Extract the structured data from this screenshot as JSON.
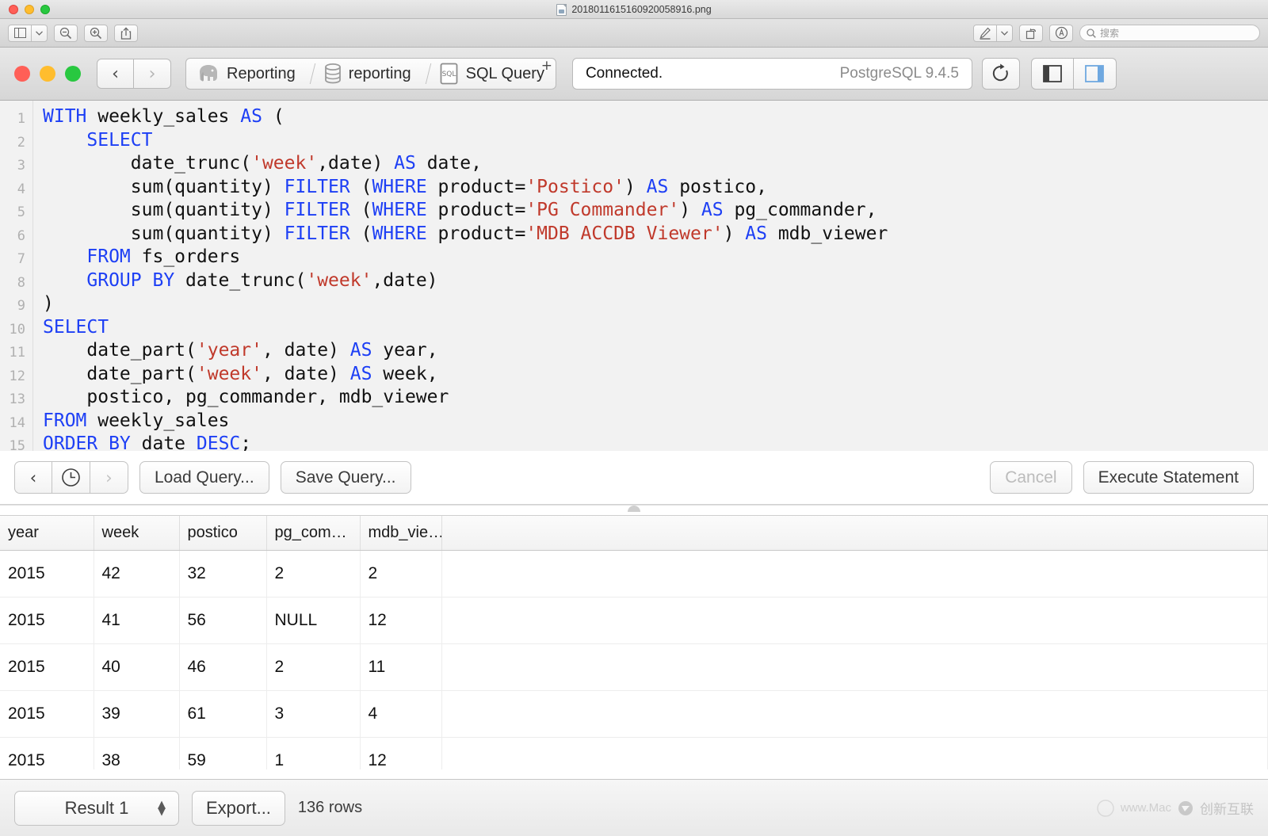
{
  "preview_window": {
    "title": "2018011615160920058916.png",
    "toolbar": {
      "sidebar_button": "sidebar-view",
      "sidebar_dropdown": "⌄",
      "zoom_out": "zoom-out",
      "zoom_in": "zoom-in",
      "share": "share",
      "markup": "markup",
      "markup_dropdown": "⌄",
      "rotate": "rotate",
      "annotate": "annotate"
    },
    "search": {
      "placeholder": "搜索"
    }
  },
  "app": {
    "breadcrumbs": [
      {
        "label": "Reporting",
        "icon": "elephant-icon"
      },
      {
        "label": "reporting",
        "icon": "database-icon"
      },
      {
        "label": "SQL Query",
        "icon": "sql-icon",
        "badge": "+"
      }
    ],
    "nav": {
      "back": "‹",
      "forward": "›"
    },
    "status": {
      "text": "Connected.",
      "version": "PostgreSQL 9.4.5"
    },
    "toolbar_icons": {
      "refresh": "refresh-icon",
      "left_pane": "left-pane-icon",
      "right_pane": "right-pane-icon"
    },
    "accent_color": "#4a90e2"
  },
  "editor": {
    "line_numbers": [
      "1",
      "2",
      "3",
      "4",
      "5",
      "6",
      "7",
      "8",
      "9",
      "10",
      "11",
      "12",
      "13",
      "14",
      "15"
    ],
    "lines": [
      [
        {
          "t": "WITH",
          "c": "kw"
        },
        {
          "t": " weekly_sales ",
          "c": "pl"
        },
        {
          "t": "AS",
          "c": "kw"
        },
        {
          "t": " (",
          "c": "pl"
        }
      ],
      [
        {
          "t": "    ",
          "c": "pl"
        },
        {
          "t": "SELECT",
          "c": "kw"
        }
      ],
      [
        {
          "t": "        date_trunc(",
          "c": "pl"
        },
        {
          "t": "'week'",
          "c": "str"
        },
        {
          "t": ",date) ",
          "c": "pl"
        },
        {
          "t": "AS",
          "c": "kw"
        },
        {
          "t": " date,",
          "c": "pl"
        }
      ],
      [
        {
          "t": "        sum(quantity) ",
          "c": "pl"
        },
        {
          "t": "FILTER",
          "c": "kw"
        },
        {
          "t": " (",
          "c": "pl"
        },
        {
          "t": "WHERE",
          "c": "kw"
        },
        {
          "t": " product=",
          "c": "pl"
        },
        {
          "t": "'Postico'",
          "c": "str"
        },
        {
          "t": ") ",
          "c": "pl"
        },
        {
          "t": "AS",
          "c": "kw"
        },
        {
          "t": " postico,",
          "c": "pl"
        }
      ],
      [
        {
          "t": "        sum(quantity) ",
          "c": "pl"
        },
        {
          "t": "FILTER",
          "c": "kw"
        },
        {
          "t": " (",
          "c": "pl"
        },
        {
          "t": "WHERE",
          "c": "kw"
        },
        {
          "t": " product=",
          "c": "pl"
        },
        {
          "t": "'PG Commander'",
          "c": "str"
        },
        {
          "t": ") ",
          "c": "pl"
        },
        {
          "t": "AS",
          "c": "kw"
        },
        {
          "t": " pg_commander,",
          "c": "pl"
        }
      ],
      [
        {
          "t": "        sum(quantity) ",
          "c": "pl"
        },
        {
          "t": "FILTER",
          "c": "kw"
        },
        {
          "t": " (",
          "c": "pl"
        },
        {
          "t": "WHERE",
          "c": "kw"
        },
        {
          "t": " product=",
          "c": "pl"
        },
        {
          "t": "'MDB ACCDB Viewer'",
          "c": "str"
        },
        {
          "t": ") ",
          "c": "pl"
        },
        {
          "t": "AS",
          "c": "kw"
        },
        {
          "t": " mdb_viewer",
          "c": "pl"
        }
      ],
      [
        {
          "t": "    ",
          "c": "pl"
        },
        {
          "t": "FROM",
          "c": "kw"
        },
        {
          "t": " fs_orders",
          "c": "pl"
        }
      ],
      [
        {
          "t": "    ",
          "c": "pl"
        },
        {
          "t": "GROUP BY",
          "c": "kw"
        },
        {
          "t": " date_trunc(",
          "c": "pl"
        },
        {
          "t": "'week'",
          "c": "str"
        },
        {
          "t": ",date)",
          "c": "pl"
        }
      ],
      [
        {
          "t": ")",
          "c": "pl"
        }
      ],
      [
        {
          "t": "SELECT",
          "c": "kw"
        }
      ],
      [
        {
          "t": "    date_part(",
          "c": "pl"
        },
        {
          "t": "'year'",
          "c": "str"
        },
        {
          "t": ", date) ",
          "c": "pl"
        },
        {
          "t": "AS",
          "c": "kw"
        },
        {
          "t": " year,",
          "c": "pl"
        }
      ],
      [
        {
          "t": "    date_part(",
          "c": "pl"
        },
        {
          "t": "'week'",
          "c": "str"
        },
        {
          "t": ", date) ",
          "c": "pl"
        },
        {
          "t": "AS",
          "c": "kw"
        },
        {
          "t": " week,",
          "c": "pl"
        }
      ],
      [
        {
          "t": "    postico, pg_commander, mdb_viewer",
          "c": "pl"
        }
      ],
      [
        {
          "t": "FROM",
          "c": "kw"
        },
        {
          "t": " weekly_sales",
          "c": "pl"
        }
      ],
      [
        {
          "t": "ORDER BY",
          "c": "kw"
        },
        {
          "t": " date ",
          "c": "pl"
        },
        {
          "t": "DESC",
          "c": "kw"
        },
        {
          "t": ";",
          "c": "pl"
        }
      ]
    ]
  },
  "query_bar": {
    "history_prev": "‹",
    "history_clock": "clock-icon",
    "history_next": "›",
    "load_query": "Load Query...",
    "save_query": "Save Query...",
    "cancel": "Cancel",
    "execute": "Execute Statement"
  },
  "results": {
    "columns": [
      "year",
      "week",
      "postico",
      "pg_com…",
      "mdb_vie…"
    ],
    "rows": [
      [
        "2015",
        "42",
        "32",
        "2",
        "2"
      ],
      [
        "2015",
        "41",
        "56",
        "NULL",
        "12"
      ],
      [
        "2015",
        "40",
        "46",
        "2",
        "11"
      ],
      [
        "2015",
        "39",
        "61",
        "3",
        "4"
      ],
      [
        "2015",
        "38",
        "59",
        "1",
        "12"
      ]
    ]
  },
  "bottom_bar": {
    "result_select": "Result 1",
    "export": "Export...",
    "row_count": "136 rows",
    "watermark_text": "www.Mac",
    "watermark_cn": "创新互联"
  }
}
